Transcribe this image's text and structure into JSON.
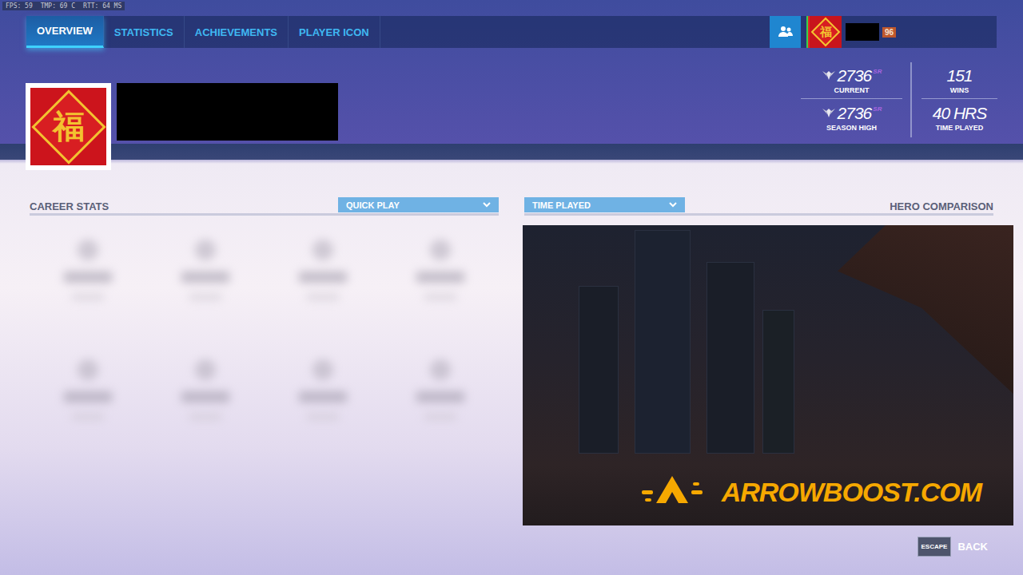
{
  "debug": [
    "FPS: 59",
    "TMP: 69 C",
    "RTT: 64 MS"
  ],
  "tabs": [
    {
      "label": "OVERVIEW",
      "selected": true
    },
    {
      "label": "STATISTICS",
      "selected": false
    },
    {
      "label": "ACHIEVEMENTS",
      "selected": false
    },
    {
      "label": "PLAYER ICON",
      "selected": false
    }
  ],
  "player": {
    "icon_glyph": "福",
    "name_redacted": true,
    "level": "96"
  },
  "stats": [
    {
      "value": "2736",
      "unit": "SR",
      "label": "CURRENT",
      "kind": "rank"
    },
    {
      "value": "2736",
      "unit": "SR",
      "label": "SEASON HIGH",
      "kind": "rank"
    },
    {
      "value": "151",
      "unit": "",
      "label": "WINS",
      "kind": "plain"
    },
    {
      "value": "40 HRS",
      "unit": "",
      "label": "TIME PLAYED",
      "kind": "plain"
    }
  ],
  "career_stats": {
    "title": "CAREER STATS",
    "mode": "QUICK PLAY",
    "blurred": true
  },
  "hero_comparison": {
    "title": "HERO COMPARISON",
    "metric": "TIME PLAYED",
    "watermark": "ARROWBOOST.COM"
  },
  "back": {
    "key": "ESCAPE",
    "label": "BACK"
  }
}
